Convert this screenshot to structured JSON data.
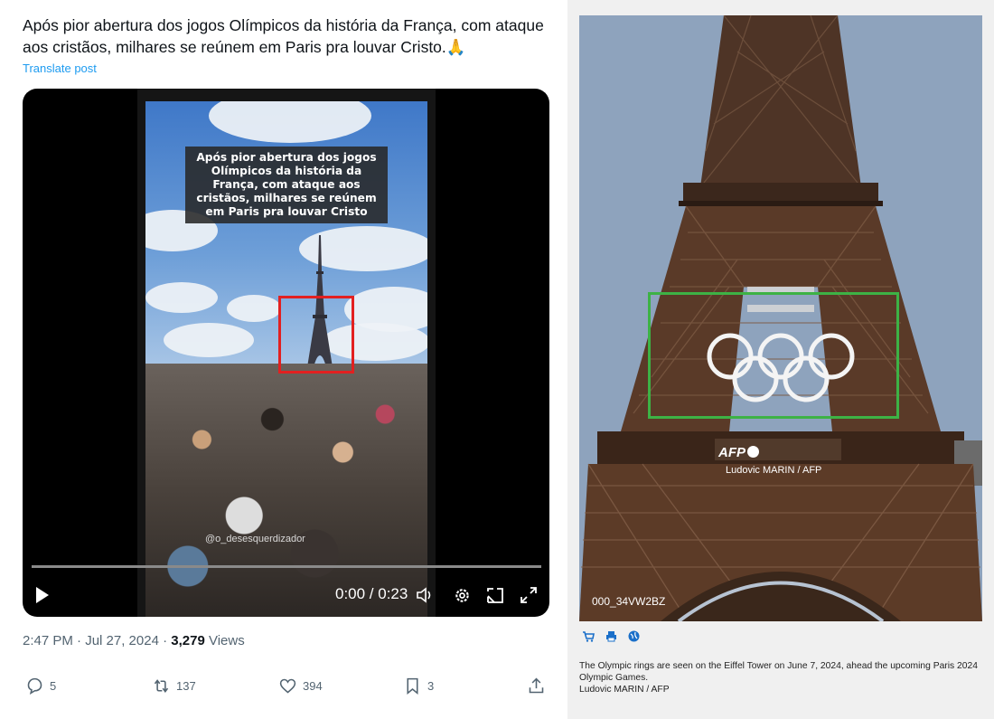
{
  "tweet": {
    "text": "Após pior abertura dos jogos Olímpicos da história da França, com ataque aos cristãos, milhares se reúnem em Paris pra louvar Cristo.🙏",
    "translate_label": "Translate post",
    "video": {
      "caption": "Após pior abertura dos jogos Olímpicos da história da França, com ataque aos cristãos, milhares se reúnem em Paris pra louvar Cristo",
      "watermark": "@o_desesquerdizador",
      "time": "0:00 / 0:23",
      "progress": 0
    },
    "meta": {
      "time_date": "2:47 PM · Jul 27, 2024 · ",
      "views_count": "3,279",
      "views_label": " Views"
    },
    "actions": {
      "replies": "5",
      "reposts": "137",
      "likes": "394",
      "bookmarks": "3"
    }
  },
  "photo_panel": {
    "logo": "AFP",
    "credit_overlay": "Ludovic MARIN / AFP",
    "photo_id": "000_34VW2BZ",
    "caption_line1": "The Olympic rings are seen on the Eiffel Tower on June 7, 2024, ahead the upcoming Paris 2024 Olympic Games.",
    "caption_line2": "Ludovic MARIN / AFP",
    "icons": [
      "cart-icon",
      "print-icon",
      "globe-icon"
    ]
  },
  "colors": {
    "link": "#1d9bf0",
    "highlight_red": "#e22020",
    "highlight_green": "#3db245",
    "tower": "#5a3a28"
  }
}
